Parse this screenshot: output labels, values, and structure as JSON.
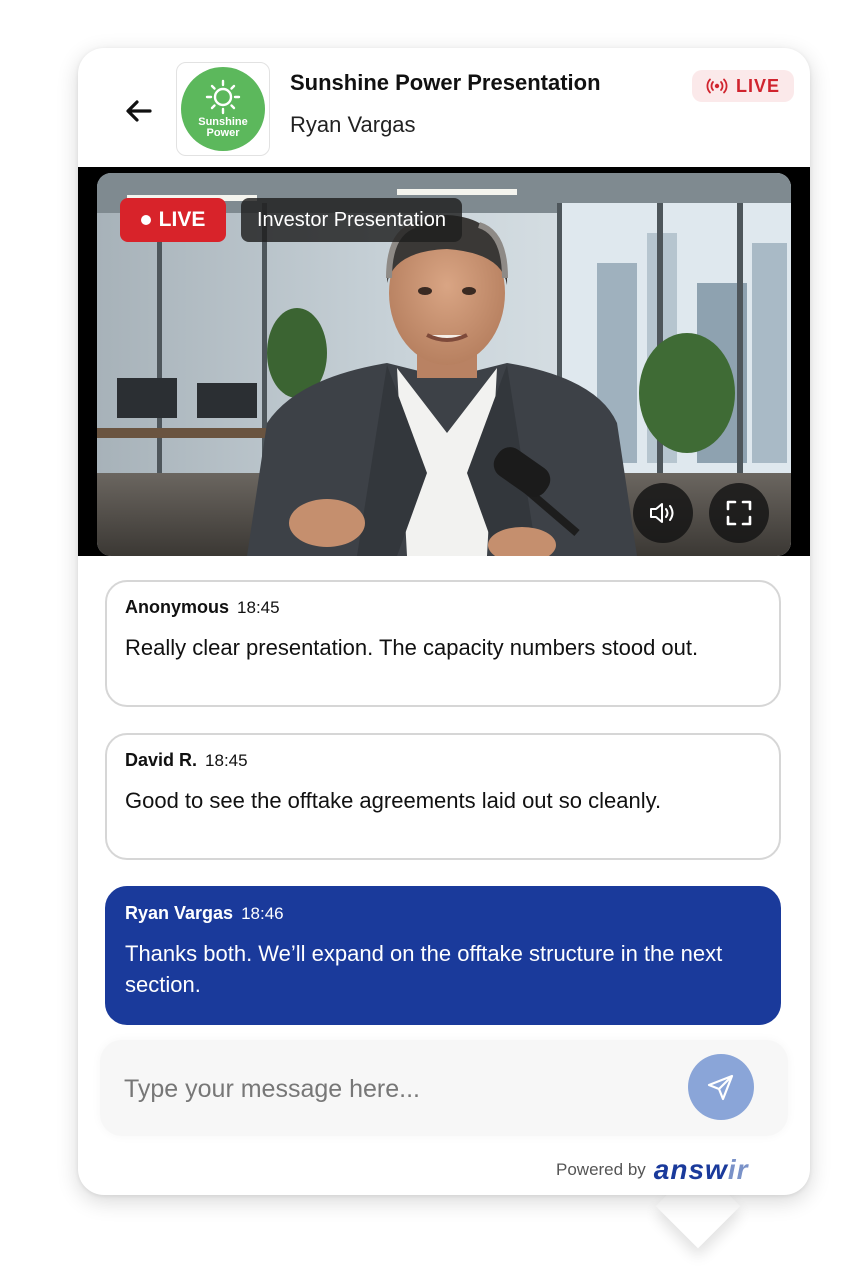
{
  "header": {
    "title": "Sunshine Power Presentation",
    "subtitle": "Ryan Vargas",
    "live_label": "LIVE",
    "logo_line1": "Sunshine",
    "logo_line2": "Power"
  },
  "video": {
    "live_label": "LIVE",
    "stream_title": "Investor Presentation"
  },
  "messages": [
    {
      "author": "Anonymous",
      "time": "18:45",
      "text": "Really clear presentation. The capacity numbers stood out."
    },
    {
      "author": "David R.",
      "time": "18:45",
      "text": "Good to see the offtake agreements laid out so cleanly."
    },
    {
      "author": "Ryan Vargas",
      "time": "18:46",
      "text": "Thanks both. We’ll expand on the offtake structure in the next section."
    }
  ],
  "composer": {
    "placeholder": "Type your message here..."
  },
  "footer": {
    "powered_by": "Powered by",
    "brand_main": "answ",
    "brand_tail": "ir"
  },
  "colors": {
    "brand_green": "#5cb85c",
    "live_red": "#d8232a",
    "own_message_blue": "#1a3a9b",
    "send_button": "#8aa5d8"
  }
}
